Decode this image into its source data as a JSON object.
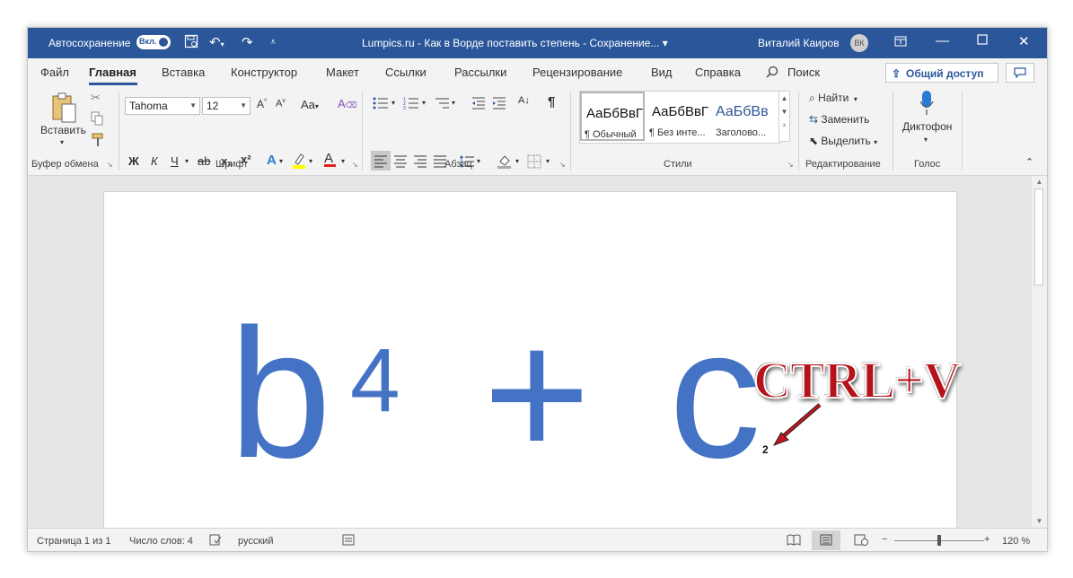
{
  "titlebar": {
    "autosave_label": "Автосохранение",
    "autosave_state": "Вкл.",
    "document_title": "Lumpics.ru - Как в Ворде поставить степень - Сохранение... ▾",
    "user_name": "Виталий Каиров",
    "user_initials": "ВК"
  },
  "tabs": [
    "Файл",
    "Главная",
    "Вставка",
    "Конструктор",
    "Макет",
    "Ссылки",
    "Рассылки",
    "Рецензирование",
    "Вид",
    "Справка"
  ],
  "search_label": "Поиск",
  "share_label": "Общий доступ",
  "ribbon": {
    "clipboard": {
      "paste_label": "Вставить",
      "group_label": "Буфер обмена"
    },
    "font": {
      "font_name": "Tahoma",
      "font_size": "12",
      "change_case": "Aa",
      "bold": "Ж",
      "italic": "К",
      "underline": "Ч",
      "strike": "ab",
      "subscript": "x₂",
      "superscript": "x²",
      "group_label": "Шрифт"
    },
    "paragraph": {
      "group_label": "Абзац",
      "show_marks": "¶"
    },
    "styles": {
      "items": [
        {
          "preview": "АаБбВвГ",
          "name": "¶ Обычный"
        },
        {
          "preview": "АаБбВвГ",
          "name": "¶ Без инте..."
        },
        {
          "preview": "АаБбВв",
          "name": "Заголово..."
        }
      ],
      "group_label": "Стили"
    },
    "editing": {
      "find": "Найти",
      "replace": "Заменить",
      "select": "Выделить",
      "group_label": "Редактирование"
    },
    "voice": {
      "dictate": "Диктофон",
      "group_label": "Голос"
    }
  },
  "document": {
    "base1": "b",
    "exp1": "4",
    "operator": "+",
    "base2": "c",
    "subscript_digit": "2",
    "formula_color": "#4472c4"
  },
  "annotation": {
    "text": "CTRL+V",
    "color": "#b5121b"
  },
  "statusbar": {
    "page": "Страница 1 из 1",
    "words": "Число слов: 4",
    "language": "русский",
    "zoom": "120 %",
    "zoom_percent": 120
  },
  "colors": {
    "brand": "#2b579a",
    "ribbon_bg": "#f3f3f3"
  }
}
